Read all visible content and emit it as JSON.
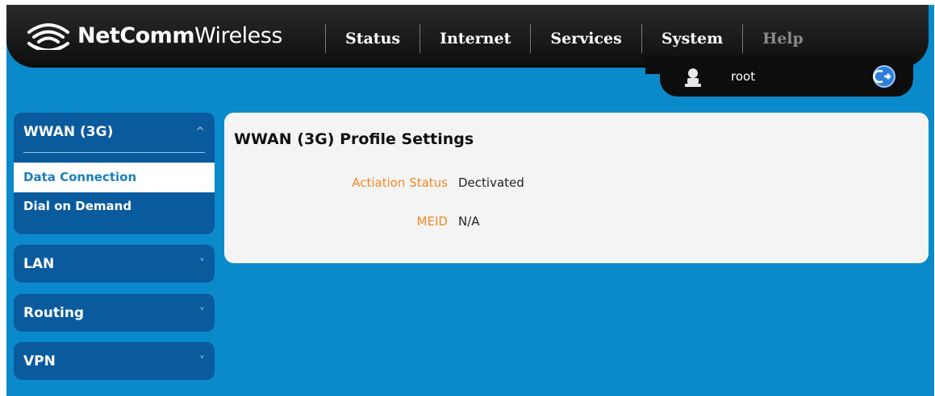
{
  "brand": {
    "bold": "NetComm",
    "light": "Wireless"
  },
  "nav": {
    "status": "Status",
    "internet": "Internet",
    "services": "Services",
    "system": "System",
    "help": "Help"
  },
  "user": {
    "name": "root"
  },
  "sidebar": {
    "wwan": {
      "title": "WWAN (3G)",
      "chevron": "^",
      "items": [
        {
          "label": "Data Connection",
          "active": true
        },
        {
          "label": "Dial on Demand",
          "active": false
        }
      ]
    },
    "lan": {
      "title": "LAN",
      "chevron": "˅"
    },
    "routing": {
      "title": "Routing",
      "chevron": "˅"
    },
    "vpn": {
      "title": "VPN",
      "chevron": "˅"
    }
  },
  "main": {
    "title": "WWAN (3G) Profile Settings",
    "fields": [
      {
        "label": "Actiation Status",
        "value": "Dectivated"
      },
      {
        "label": "MEID",
        "value": "N/A"
      }
    ]
  },
  "colors": {
    "background": "#0b8acb",
    "panel": "#0a5a9e",
    "label": "#f08a24",
    "active_link": "#1a7fc1"
  }
}
